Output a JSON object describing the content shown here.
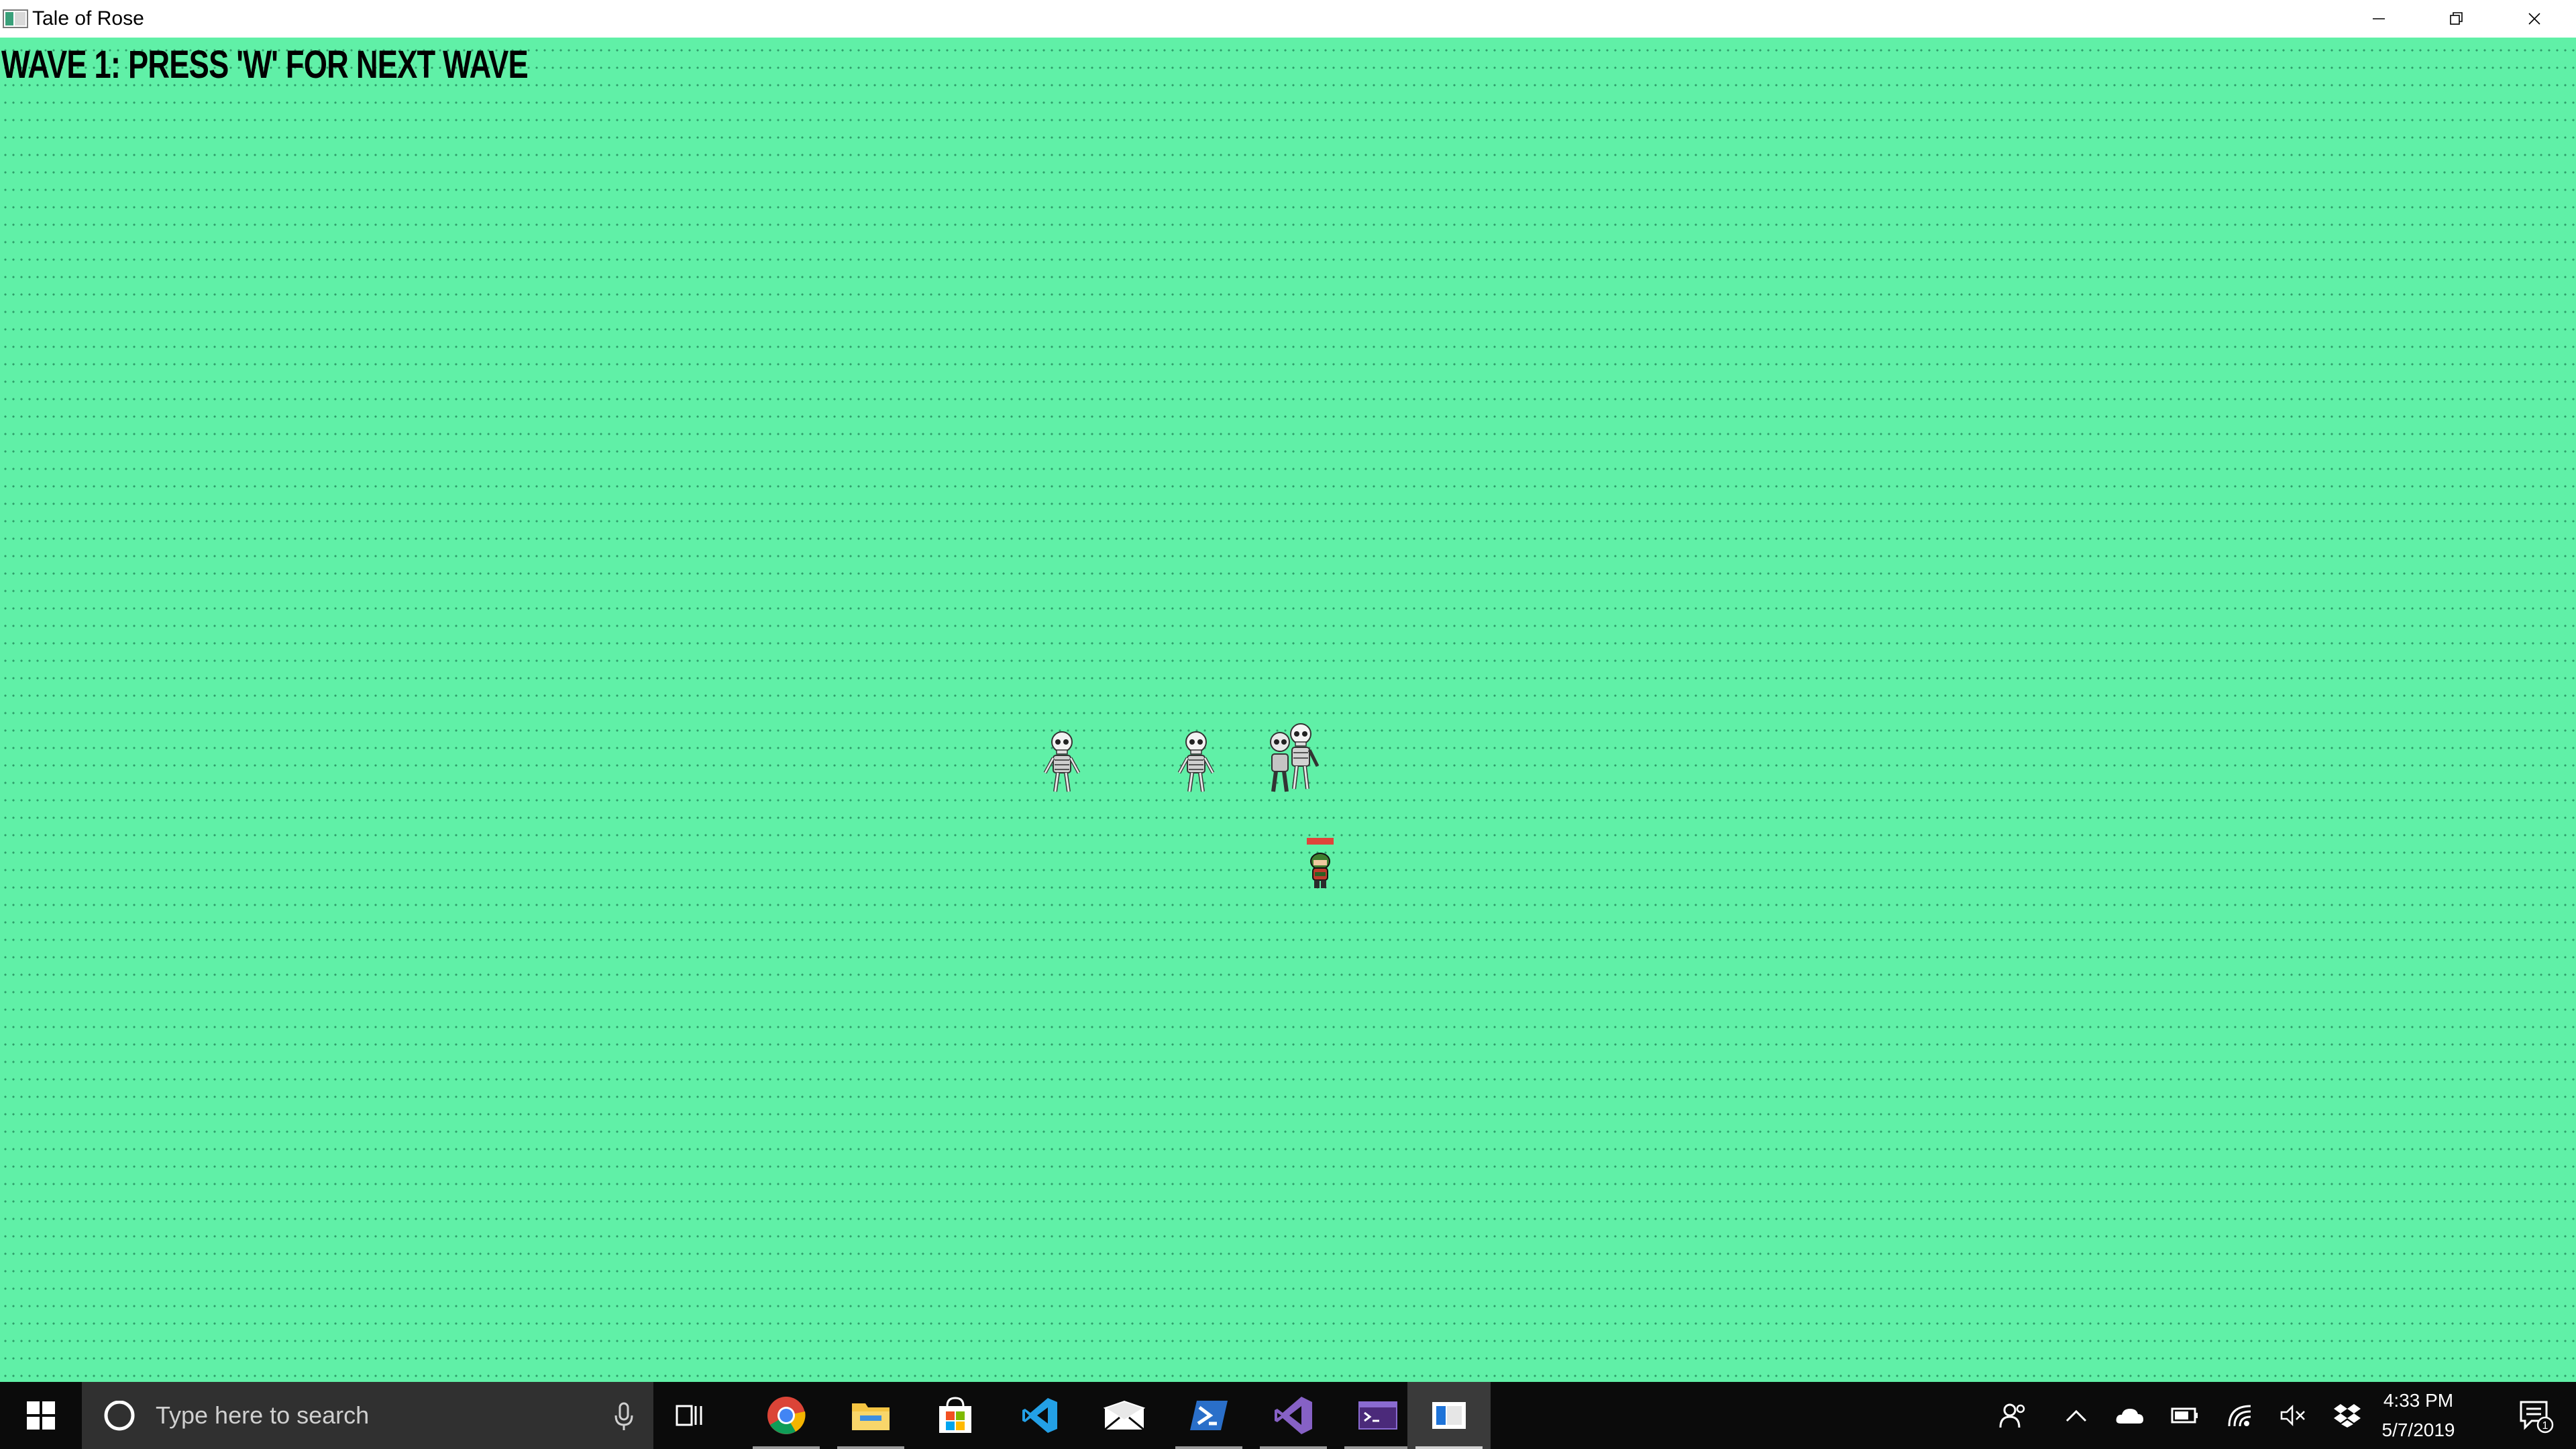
{
  "window": {
    "title": "Tale of Rose",
    "controls": [
      "minimize",
      "restore",
      "close"
    ]
  },
  "game": {
    "wave_text": "WAVE 1: PRESS 'W' FOR NEXT WAVE",
    "background_color": "#60f0a7",
    "enemies": [
      {
        "type": "skeleton"
      },
      {
        "type": "skeleton"
      },
      {
        "type": "skeleton-group"
      }
    ],
    "player": {
      "type": "rose-hero",
      "health_bar_color": "#e0443a"
    }
  },
  "taskbar": {
    "search_placeholder": "Type here to search",
    "pinned_apps": [
      "chrome-icon",
      "file-explorer-icon",
      "store-icon",
      "vscode-icon",
      "mail-icon",
      "powershell-icon",
      "visual-studio-icon",
      "terminal-icon",
      "game-window-icon"
    ],
    "tray_icons": [
      "people-icon",
      "chevron-up-icon",
      "onedrive-icon",
      "battery-icon",
      "wifi-icon",
      "volume-muted-icon",
      "dropbox-icon"
    ],
    "time": "4:33 PM",
    "date": "5/7/2019",
    "notification_count": "1"
  }
}
